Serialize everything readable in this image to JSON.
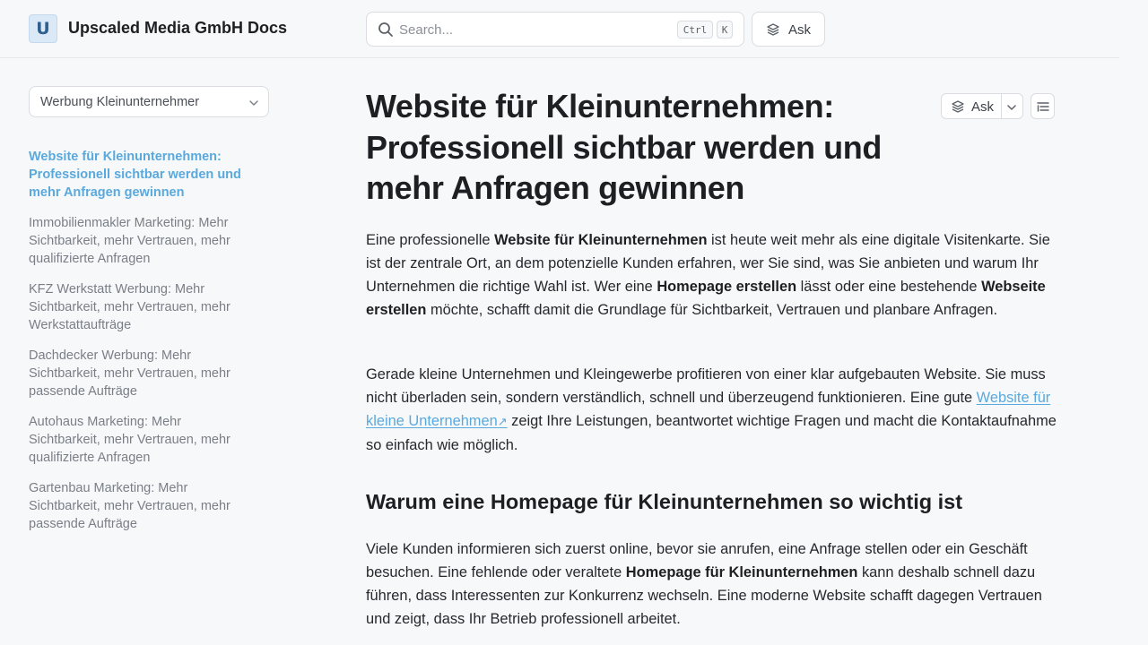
{
  "header": {
    "logo_letter": "U",
    "site_title": "Upscaled Media GmbH Docs",
    "search": {
      "placeholder": "Search...",
      "shortcut_ctrl": "Ctrl",
      "shortcut_key": "K"
    },
    "ask_label": "Ask"
  },
  "sidebar": {
    "select_value": "Werbung Kleinunternehmer",
    "items": [
      {
        "label": "Website für Kleinunternehmen: Professionell sichtbar werden und mehr Anfragen gewinnen",
        "active": true
      },
      {
        "label": "Immobilienmakler Marketing: Mehr Sichtbarkeit, mehr Vertrauen, mehr qualifizierte Anfragen",
        "active": false
      },
      {
        "label": "KFZ Werkstatt Werbung: Mehr Sichtbarkeit, mehr Vertrauen, mehr Werkstattaufträge",
        "active": false
      },
      {
        "label": "Dachdecker Werbung: Mehr Sichtbarkeit, mehr Vertrauen, mehr passende Aufträge",
        "active": false
      },
      {
        "label": "Autohaus Marketing: Mehr Sichtbarkeit, mehr Vertrauen, mehr qualifizierte Anfragen",
        "active": false
      },
      {
        "label": "Gartenbau Marketing: Mehr Sichtbarkeit, mehr Vertrauen, mehr passende Aufträge",
        "active": false
      }
    ]
  },
  "article": {
    "title": "Website für Kleinunternehmen: Professionell sichtbar werden und mehr Anfragen gewinnen",
    "ask_label": "Ask",
    "p1": {
      "t1": "Eine professionelle ",
      "b1": "Website für Kleinunternehmen",
      "t2": " ist heute weit mehr als eine digitale Visitenkarte. Sie ist der zentrale Ort, an dem potenzielle Kunden erfahren, wer Sie sind, was Sie anbieten und warum Ihr Unternehmen die richtige Wahl ist. Wer eine ",
      "b2": "Homepage erstellen",
      "t3": " lässt oder eine bestehende ",
      "b3": "Webseite erstellen",
      "t4": " möchte, schafft damit die Grundlage für Sichtbarkeit, Vertrauen und planbare Anfragen."
    },
    "p2": {
      "t1": "Gerade kleine Unternehmen und Kleingewerbe profitieren von einer klar aufgebauten Website. Sie muss nicht überladen sein, sondern verständlich, schnell und überzeugend funktionieren. Eine gute ",
      "link": "Website für kleine Unternehmen",
      "link_icon": "↗",
      "t2": " zeigt Ihre Leistungen, beantwortet wichtige Fragen und macht die Kontaktaufnahme so einfach wie möglich."
    },
    "h2": "Warum eine Homepage für Kleinunternehmen so wichtig ist",
    "p3": {
      "t1": "Viele Kunden informieren sich zuerst online, bevor sie anrufen, eine Anfrage stellen oder ein Geschäft besuchen. Eine fehlende oder veraltete ",
      "b1": "Homepage für Kleinunternehmen",
      "t2": " kann deshalb schnell dazu führen, dass Interessenten zur Konkurrenz wechseln. Eine moderne Website schafft dagegen Vertrauen und zeigt, dass Ihr Betrieb professionell arbeitet."
    }
  },
  "colors": {
    "accent": "#5aa9dd",
    "background": "#f7f8fa",
    "logo_bg": "#dbe9f7"
  }
}
